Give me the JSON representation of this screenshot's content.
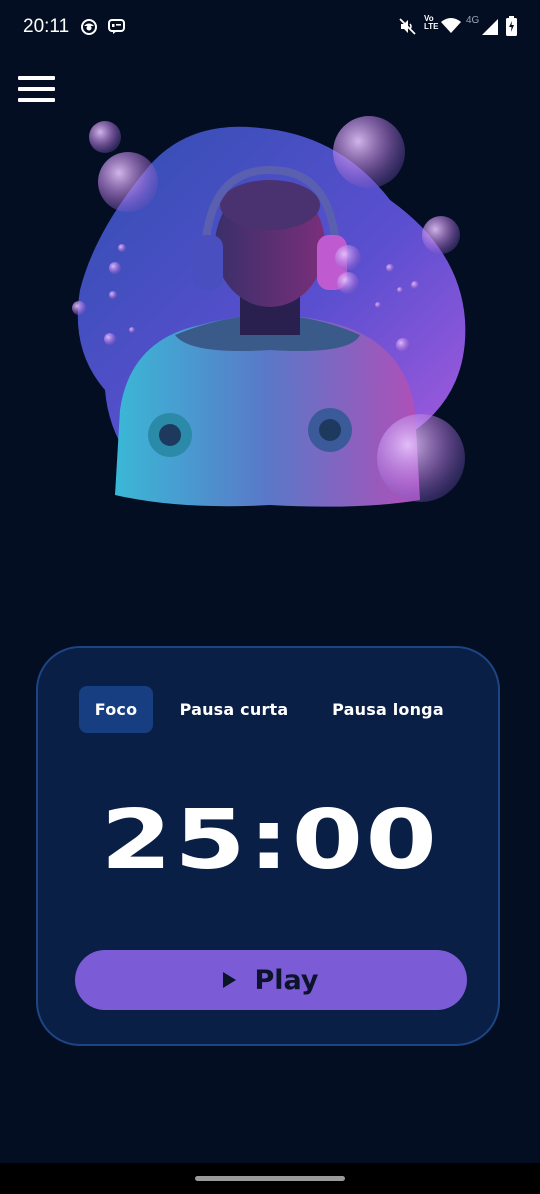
{
  "status_bar": {
    "time": "20:11",
    "lte_top": "Vo",
    "lte_bottom": "LTE",
    "network": "4G",
    "icons": [
      "chrome-like-icon",
      "messages-icon",
      "mute-icon",
      "volte-icon",
      "wifi-icon",
      "signal-icon",
      "battery-icon"
    ]
  },
  "menu": {
    "icon": "hamburger-menu-icon"
  },
  "hero": {
    "icon": "astronaut-headphones-illustration"
  },
  "timer": {
    "tabs": [
      {
        "label": "Foco",
        "active": true
      },
      {
        "label": "Pausa curta",
        "active": false
      },
      {
        "label": "Pausa longa",
        "active": false
      }
    ],
    "display": "25:00",
    "play_label": "Play"
  },
  "colors": {
    "background": "#040e22",
    "card": "#0a1f45",
    "card_border": "#1d4584",
    "active_tab": "#163e80",
    "play_button": "#7b5bd6"
  }
}
